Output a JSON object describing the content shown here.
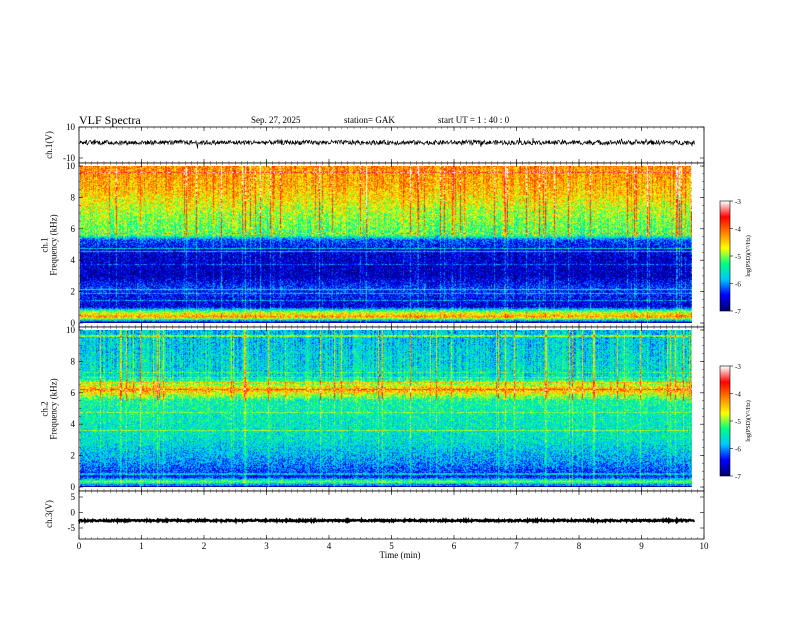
{
  "header": {
    "title": "VLF  Spectra",
    "date": "Sep. 27, 2025",
    "station": "station= GAK",
    "start": "start  UT =   1  : 40 : 0"
  },
  "chart_data": [
    {
      "type": "line",
      "name": "ch1-voltage",
      "ylabel": "ch.1(V)",
      "ylim": [
        -10,
        10
      ],
      "yticks": [
        "10",
        "-10"
      ],
      "xlim": [
        0,
        10
      ],
      "approx_level": 0,
      "noise_amplitude": 1.5
    },
    {
      "type": "heatmap",
      "name": "ch1-spectrogram",
      "ylabel": "ch.1\nFrequency (kHz)",
      "ylabel_lines": [
        "ch.1",
        "Frequency  (kHz)"
      ],
      "ylim": [
        0,
        10
      ],
      "yticks": [
        "0",
        "2",
        "4",
        "6",
        "8",
        "10"
      ],
      "xlim": [
        0,
        9.8
      ],
      "colorbar": {
        "label": "log(PSD)(V²/Hz)",
        "range": [
          -7,
          -3
        ],
        "ticks": [
          "-3",
          "-4",
          "-5",
          "-6",
          "-7"
        ],
        "colors": [
          "#000070",
          "#0000ff",
          "#00c8ff",
          "#00ff80",
          "#ffff00",
          "#ff7f00",
          "#ff0000",
          "#ffffff"
        ]
      },
      "profile": [
        {
          "f": 0.0,
          "v": -6.8
        },
        {
          "f": 0.35,
          "v": -4.2
        },
        {
          "f": 0.7,
          "v": -5.0
        },
        {
          "f": 1.0,
          "v": -6.6
        },
        {
          "f": 2.2,
          "v": -6.3
        },
        {
          "f": 3.0,
          "v": -6.7
        },
        {
          "f": 4.5,
          "v": -6.6
        },
        {
          "f": 5.3,
          "v": -6.2
        },
        {
          "f": 5.6,
          "v": -5.2
        },
        {
          "f": 7.0,
          "v": -4.9
        },
        {
          "f": 8.5,
          "v": -4.4
        },
        {
          "f": 10.0,
          "v": -4.2
        }
      ]
    },
    {
      "type": "heatmap",
      "name": "ch2-spectrogram",
      "ylabel": "ch.2\nFrequency (kHz)",
      "ylabel_lines": [
        "ch.2",
        "Frequency  (kHz)"
      ],
      "ylim": [
        0,
        10
      ],
      "yticks": [
        "0",
        "2",
        "4",
        "6",
        "8",
        "10"
      ],
      "xlim": [
        0,
        9.8
      ],
      "colorbar": {
        "label": "log(PSD)(V²/Hz)",
        "range": [
          -7,
          -3
        ],
        "ticks": [
          "-3",
          "-4",
          "-5",
          "-6",
          "-7"
        ],
        "colors": [
          "#000070",
          "#0000ff",
          "#00c8ff",
          "#00ff80",
          "#ffff00",
          "#ff7f00",
          "#ff0000",
          "#ffffff"
        ]
      },
      "profile": [
        {
          "f": 0.0,
          "v": -6.8
        },
        {
          "f": 0.3,
          "v": -5.0
        },
        {
          "f": 0.6,
          "v": -6.4
        },
        {
          "f": 1.5,
          "v": -6.0
        },
        {
          "f": 3.0,
          "v": -5.6
        },
        {
          "f": 4.5,
          "v": -5.5
        },
        {
          "f": 5.5,
          "v": -5.4
        },
        {
          "f": 6.2,
          "v": -4.3
        },
        {
          "f": 7.0,
          "v": -5.6
        },
        {
          "f": 8.5,
          "v": -5.7
        },
        {
          "f": 10.0,
          "v": -5.8
        }
      ]
    },
    {
      "type": "line",
      "name": "ch3-voltage",
      "ylabel": "ch.3(V)",
      "ylim": [
        -5,
        5
      ],
      "yticks": [
        "5",
        "0",
        "-5"
      ],
      "xlim": [
        0,
        10
      ],
      "approx_level": -2.6,
      "noise_amplitude": 0.25
    }
  ],
  "x_axis": {
    "label": "Time  (min)",
    "ticks": [
      "0",
      "1",
      "2",
      "3",
      "4",
      "5",
      "6",
      "7",
      "8",
      "9",
      "10"
    ],
    "range": [
      0,
      10
    ]
  }
}
